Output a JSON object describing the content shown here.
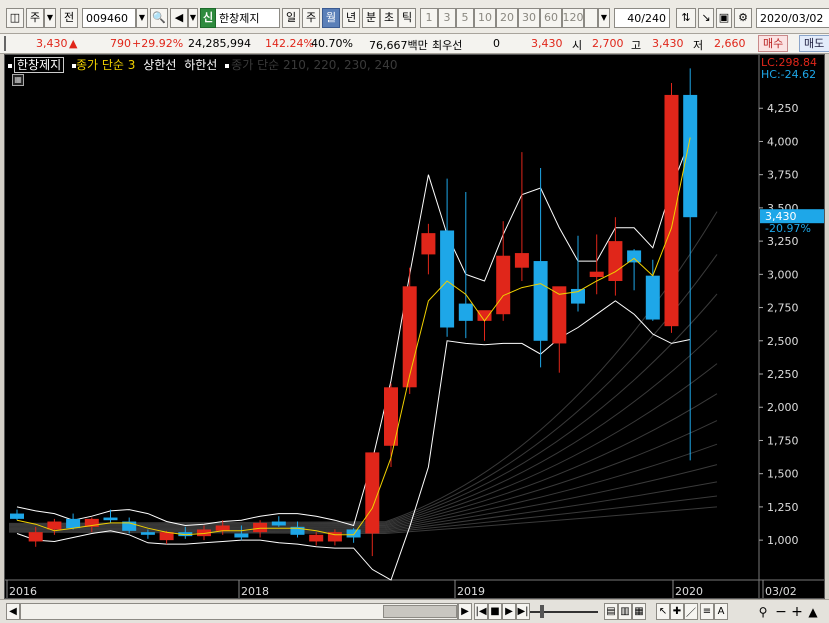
{
  "toolbar": {
    "period_type": "주",
    "prev_label": "전",
    "code": "009460",
    "new_badge": "신",
    "stock_name": "한창제지",
    "tabs": [
      "일",
      "주",
      "월",
      "년"
    ],
    "active_tab": "월",
    "minute_tabs": [
      "분",
      "초",
      "틱"
    ],
    "intervals": [
      "1",
      "3",
      "5",
      "10",
      "20",
      "30",
      "60",
      "120"
    ],
    "count": "40",
    "count_total": "/240",
    "date": "2020/03/02"
  },
  "quote": {
    "price": "3,430",
    "arrow": "▲",
    "change": "790",
    "change_pct": "+29.92%",
    "volume": "24,285,994",
    "volume_ratio": "142.24%",
    "turnover": "40.70%",
    "amount": "76,667백만",
    "priority_label": "최우선",
    "priority_value": "0",
    "ask": "3,430",
    "open_label": "시",
    "open": "2,700",
    "high_label": "고",
    "high": "3,430",
    "low_label": "저",
    "low": "2,660",
    "buy_label": "매수",
    "sell_label": "매도"
  },
  "legend": {
    "stock": "한창제지",
    "ma": "종가 단순 3",
    "upper": "상한선",
    "lower": "하한선",
    "ma2": "종가 단순 210, 220, 230, 240"
  },
  "overlay": {
    "lc": "LC:298.84",
    "hc": "HC:-24.62",
    "last_price": "3,430",
    "last_pct": "-20.97%"
  },
  "x_labels": [
    "2016",
    "2018",
    "2019",
    "2020",
    "03/02"
  ],
  "colors": {
    "up": "#e0261a",
    "down": "#1ea7e8",
    "ma": "#f0d000",
    "envelope": "#ffffff",
    "grid": "#333333"
  },
  "chart_data": {
    "type": "candlestick",
    "ylim": [
      700,
      4500
    ],
    "yticks": [
      "1,000",
      "1,250",
      "1,500",
      "1,750",
      "2,000",
      "2,250",
      "2,500",
      "2,750",
      "3,000",
      "3,250",
      "3,500",
      "3,750",
      "4,000",
      "4,250"
    ],
    "ytick_values": [
      1000,
      1250,
      1500,
      1750,
      2000,
      2250,
      2500,
      2750,
      3000,
      3250,
      3500,
      3750,
      4000,
      4250
    ],
    "candles": [
      {
        "o": 1200,
        "h": 1230,
        "l": 1150,
        "c": 1160
      },
      {
        "o": 990,
        "h": 1100,
        "l": 950,
        "c": 1060
      },
      {
        "o": 1080,
        "h": 1160,
        "l": 1040,
        "c": 1140
      },
      {
        "o": 1160,
        "h": 1200,
        "l": 1080,
        "c": 1090
      },
      {
        "o": 1100,
        "h": 1170,
        "l": 1060,
        "c": 1160
      },
      {
        "o": 1170,
        "h": 1230,
        "l": 1130,
        "c": 1150
      },
      {
        "o": 1140,
        "h": 1170,
        "l": 1050,
        "c": 1070
      },
      {
        "o": 1060,
        "h": 1080,
        "l": 1010,
        "c": 1040
      },
      {
        "o": 1000,
        "h": 1070,
        "l": 970,
        "c": 1060
      },
      {
        "o": 1060,
        "h": 1100,
        "l": 1010,
        "c": 1030
      },
      {
        "o": 1030,
        "h": 1110,
        "l": 1000,
        "c": 1080
      },
      {
        "o": 1070,
        "h": 1150,
        "l": 1040,
        "c": 1110
      },
      {
        "o": 1050,
        "h": 1110,
        "l": 1000,
        "c": 1020
      },
      {
        "o": 1060,
        "h": 1150,
        "l": 1020,
        "c": 1130
      },
      {
        "o": 1140,
        "h": 1180,
        "l": 1100,
        "c": 1110
      },
      {
        "o": 1100,
        "h": 1140,
        "l": 1020,
        "c": 1040
      },
      {
        "o": 990,
        "h": 1060,
        "l": 960,
        "c": 1040
      },
      {
        "o": 990,
        "h": 1080,
        "l": 960,
        "c": 1060
      },
      {
        "o": 1080,
        "h": 1090,
        "l": 980,
        "c": 1020
      },
      {
        "o": 1050,
        "h": 1150,
        "l": 880,
        "c": 1660
      },
      {
        "o": 1710,
        "h": 2180,
        "l": 1550,
        "c": 2150
      },
      {
        "o": 2150,
        "h": 3050,
        "l": 2100,
        "c": 2910
      },
      {
        "o": 3150,
        "h": 3380,
        "l": 3000,
        "c": 3310
      },
      {
        "o": 3330,
        "h": 3720,
        "l": 2530,
        "c": 2600
      },
      {
        "o": 2780,
        "h": 3620,
        "l": 2520,
        "c": 2650
      },
      {
        "o": 2650,
        "h": 2720,
        "l": 2500,
        "c": 2730
      },
      {
        "o": 2700,
        "h": 3400,
        "l": 2650,
        "c": 3140
      },
      {
        "o": 3050,
        "h": 3920,
        "l": 2950,
        "c": 3160
      },
      {
        "o": 3100,
        "h": 3800,
        "l": 2300,
        "c": 2500
      },
      {
        "o": 2480,
        "h": 2810,
        "l": 2260,
        "c": 2910
      },
      {
        "o": 2890,
        "h": 3290,
        "l": 2720,
        "c": 2780
      },
      {
        "o": 2980,
        "h": 3300,
        "l": 2850,
        "c": 3020
      },
      {
        "o": 2950,
        "h": 3430,
        "l": 2840,
        "c": 3250
      },
      {
        "o": 3180,
        "h": 3190,
        "l": 2880,
        "c": 3090
      },
      {
        "o": 2990,
        "h": 3110,
        "l": 2650,
        "c": 2660
      },
      {
        "o": 2610,
        "h": 4440,
        "l": 2560,
        "c": 4350
      },
      {
        "o": 4350,
        "h": 4550,
        "l": 1600,
        "c": 3430
      }
    ],
    "ma": [
      1150,
      1120,
      1070,
      1090,
      1110,
      1130,
      1130,
      1090,
      1060,
      1040,
      1050,
      1070,
      1070,
      1090,
      1090,
      1090,
      1070,
      1040,
      1040,
      1240,
      1620,
      2240,
      2800,
      2950,
      2850,
      2650,
      2840,
      2900,
      2930,
      2850,
      2870,
      2950,
      3020,
      3120,
      2990,
      3350,
      4030
    ],
    "upper": [
      1250,
      1220,
      1200,
      1150,
      1180,
      1220,
      1230,
      1200,
      1140,
      1110,
      1120,
      1140,
      1150,
      1180,
      1200,
      1200,
      1180,
      1150,
      1110,
      1600,
      2200,
      3000,
      3750,
      3300,
      3000,
      2950,
      3300,
      3600,
      3650,
      3350,
      3100,
      3100,
      3350,
      3350,
      3200,
      3650,
      4020
    ],
    "lower": [
      1050,
      1000,
      990,
      1020,
      1050,
      1070,
      1040,
      980,
      970,
      970,
      980,
      990,
      1000,
      1000,
      980,
      970,
      950,
      940,
      940,
      780,
      700,
      1100,
      1550,
      2500,
      2480,
      2470,
      2480,
      2480,
      2400,
      2520,
      2600,
      2700,
      2800,
      2700,
      2550,
      2480,
      2510
    ]
  }
}
